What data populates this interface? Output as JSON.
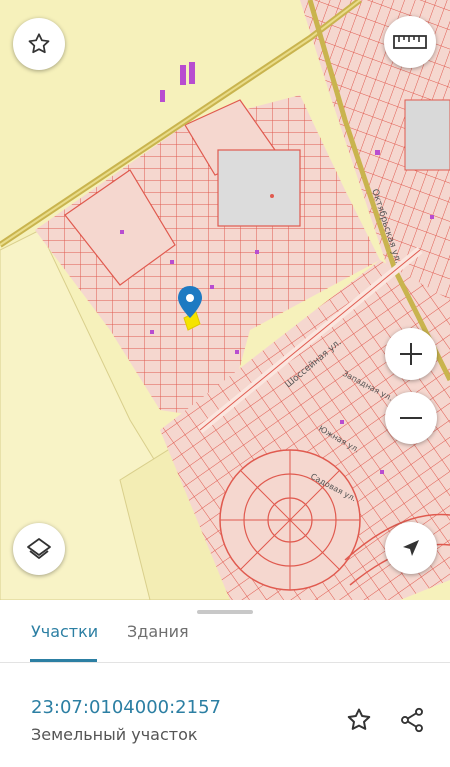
{
  "map": {
    "street_labels": [
      "Октябрьская ул.",
      "Шоссейная ул.",
      "Западная ул.",
      "Южная ул.",
      "Садовая ул."
    ],
    "colors": {
      "field": "#f6f1bb",
      "parcel_fill": "#f5d7cf",
      "parcel_line": "#e05a4f",
      "main_road": "#c9b44e",
      "marker": "#1e7ac2",
      "highlight": "#f5e400"
    }
  },
  "controls": {
    "favorite": "star-icon",
    "ruler": "ruler-icon",
    "zoom_in": "plus-icon",
    "zoom_out": "minus-icon",
    "layers": "layers-icon",
    "locate": "navigation-arrow-icon"
  },
  "sheet": {
    "tabs": [
      {
        "label": "Участки",
        "active": true
      },
      {
        "label": "Здания",
        "active": false
      }
    ],
    "cadastral_number": "23:07:0104000:2157",
    "object_type": "Земельный участок"
  }
}
